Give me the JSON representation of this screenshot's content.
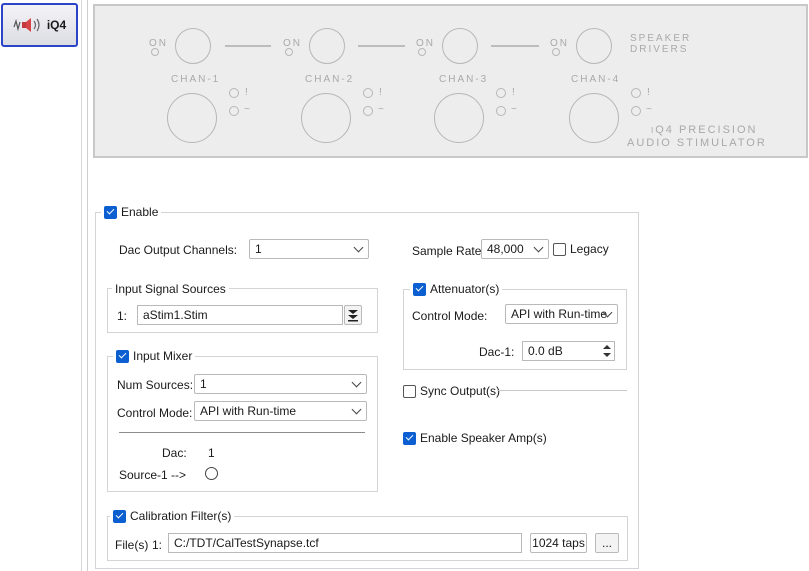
{
  "device": {
    "name": "iQ4",
    "icon": "speaker-signal-icon"
  },
  "panel": {
    "on_label": "ON",
    "speaker_drivers": [
      "SPEAKER",
      "DRIVERS"
    ],
    "channels": [
      "CHAN-1",
      "CHAN-2",
      "CHAN-3",
      "CHAN-4"
    ],
    "clip_mark": "!",
    "signal_mark": "~",
    "product": [
      "iQ4 PRECISION",
      "AUDIO STIMULATOR"
    ]
  },
  "enable": {
    "label": "Enable",
    "checked": true
  },
  "dac_output": {
    "label": "Dac Output Channels:",
    "value": "1"
  },
  "sample_rate": {
    "label": "Sample Rate:",
    "value": "48,000"
  },
  "legacy": {
    "label": "Legacy",
    "checked": false
  },
  "input_sources": {
    "title": "Input Signal Sources",
    "row_label": "1:",
    "value": "aStim1.Stim"
  },
  "attenuators": {
    "title": "Attenuator(s)",
    "checked": true,
    "control_label": "Control Mode:",
    "control_value": "API with Run-time",
    "dac_label": "Dac-1:",
    "dac_value": "0.0 dB"
  },
  "input_mixer": {
    "title": "Input Mixer",
    "checked": true,
    "num_label": "Num Sources:",
    "num_value": "1",
    "control_label": "Control Mode:",
    "control_value": "API with Run-time",
    "dac_label": "Dac:",
    "dac_value": "1",
    "source_label": "Source-1  -->"
  },
  "sync": {
    "label": "Sync Output(s)",
    "checked": false
  },
  "speaker_amp": {
    "label": "Enable Speaker Amp(s)",
    "checked": true
  },
  "calibration": {
    "title": "Calibration Filter(s)",
    "checked": true,
    "files_label": "File(s)",
    "row_label": "1:",
    "path": "C:/TDT/CalTestSynapse.tcf",
    "taps": "1024 taps",
    "browse": "..."
  }
}
